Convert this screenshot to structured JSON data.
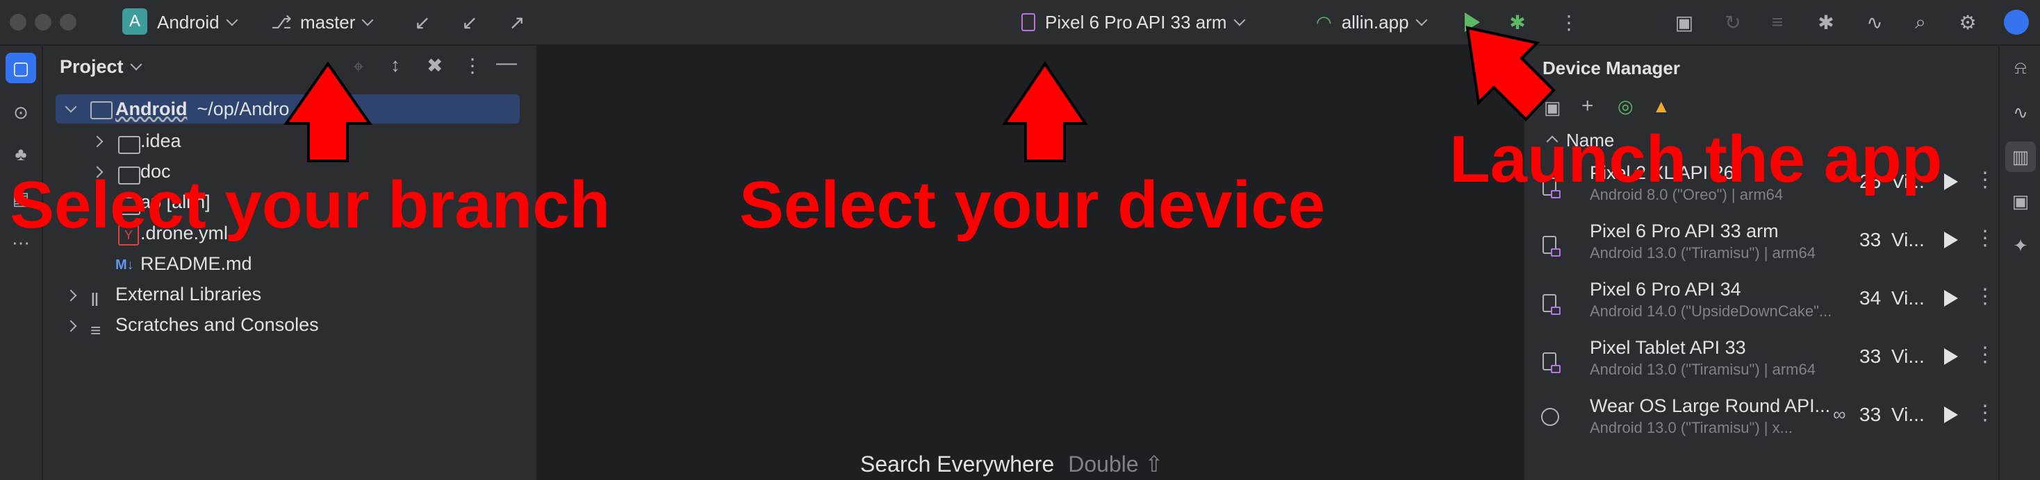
{
  "titlebar": {
    "project_badge": "A",
    "project_name": "Android",
    "branch": "master",
    "device_selector": "Pixel 6 Pro API 33 arm",
    "run_config": "allin.app"
  },
  "project_panel": {
    "title": "Project",
    "root_name": "Android",
    "root_path": "~/op/Andro",
    "items": [
      {
        "label": ".idea"
      },
      {
        "label": "doc"
      },
      {
        "label": "allin",
        "prefix": "ap"
      },
      {
        "label": ".drone.yml"
      },
      {
        "label": "README.md"
      }
    ],
    "external_libraries": "External Libraries",
    "scratches": "Scratches and Consoles"
  },
  "device_manager": {
    "title": "Device Manager",
    "column_name": "Name",
    "devices": [
      {
        "name": "Pixel 2 XL API 26",
        "sub": "Android 8.0 (\"Oreo\") | arm64",
        "api": "26",
        "type": "Vi..."
      },
      {
        "name": "Pixel 6 Pro API 33 arm",
        "sub": "Android 13.0 (\"Tiramisu\") | arm64",
        "api": "33",
        "type": "Vi..."
      },
      {
        "name": "Pixel 6 Pro API 34",
        "sub": "Android 14.0 (\"UpsideDownCake\"...",
        "api": "34",
        "type": "Vi..."
      },
      {
        "name": "Pixel Tablet API 33",
        "sub": "Android 13.0 (\"Tiramisu\") | arm64",
        "api": "33",
        "type": "Vi..."
      },
      {
        "name": "Wear OS Large Round API...",
        "sub": "Android 13.0 (\"Tiramisu\") | x...",
        "api": "33",
        "type": "Vi..."
      }
    ]
  },
  "editor": {
    "search_everywhere": "Search Everywhere",
    "shortcut": "Double ⇧"
  },
  "annotations": {
    "branch": "Select your branch",
    "device": "Select your device",
    "launch": "Launch the app"
  },
  "colors": {
    "annotation": "#ff0000",
    "accent": "#3574f0",
    "run_green": "#5fb865",
    "android_badge": "#3d9d9b"
  }
}
